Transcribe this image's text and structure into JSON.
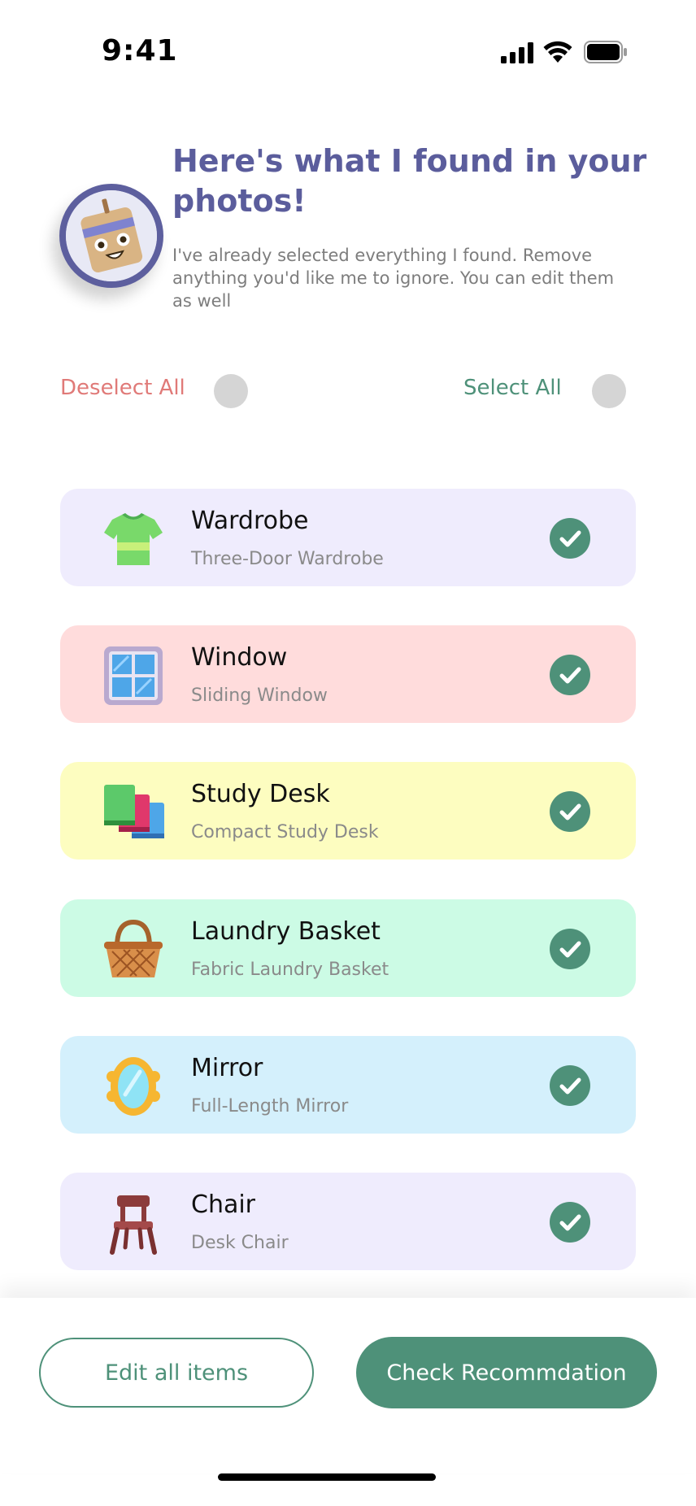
{
  "status": {
    "time": "9:41"
  },
  "header": {
    "title": "Here's what I found in your photos!",
    "subtitle": "I've already selected everything I found. Remove anything you'd like me to ignore. You can edit them as well"
  },
  "controls": {
    "deselect_all": "Deselect All",
    "select_all": "Select All"
  },
  "items": [
    {
      "title": "Wardrobe",
      "subtitle": "Three-Door Wardrobe",
      "bg": "#efecfd",
      "icon": "tshirt-icon"
    },
    {
      "title": "Window",
      "subtitle": "Sliding Window",
      "bg": "#ffdcdc",
      "icon": "window-icon"
    },
    {
      "title": "Study Desk",
      "subtitle": "Compact Study Desk",
      "bg": "#fdfdc0",
      "icon": "books-icon"
    },
    {
      "title": "Laundry Basket",
      "subtitle": "Fabric Laundry Basket",
      "bg": "#ccfbe5",
      "icon": "basket-icon"
    },
    {
      "title": "Mirror",
      "subtitle": "Full-Length Mirror",
      "bg": "#d4f0fc",
      "icon": "mirror-icon"
    },
    {
      "title": "Chair",
      "subtitle": "Desk Chair",
      "bg": "#efecfd",
      "icon": "chair-icon"
    }
  ],
  "actions": {
    "edit_all": "Edit all items",
    "check": "Check Recommdation"
  },
  "colors": {
    "accent": "#4e9179",
    "heading": "#5b5d9c",
    "danger": "#e07a78"
  }
}
